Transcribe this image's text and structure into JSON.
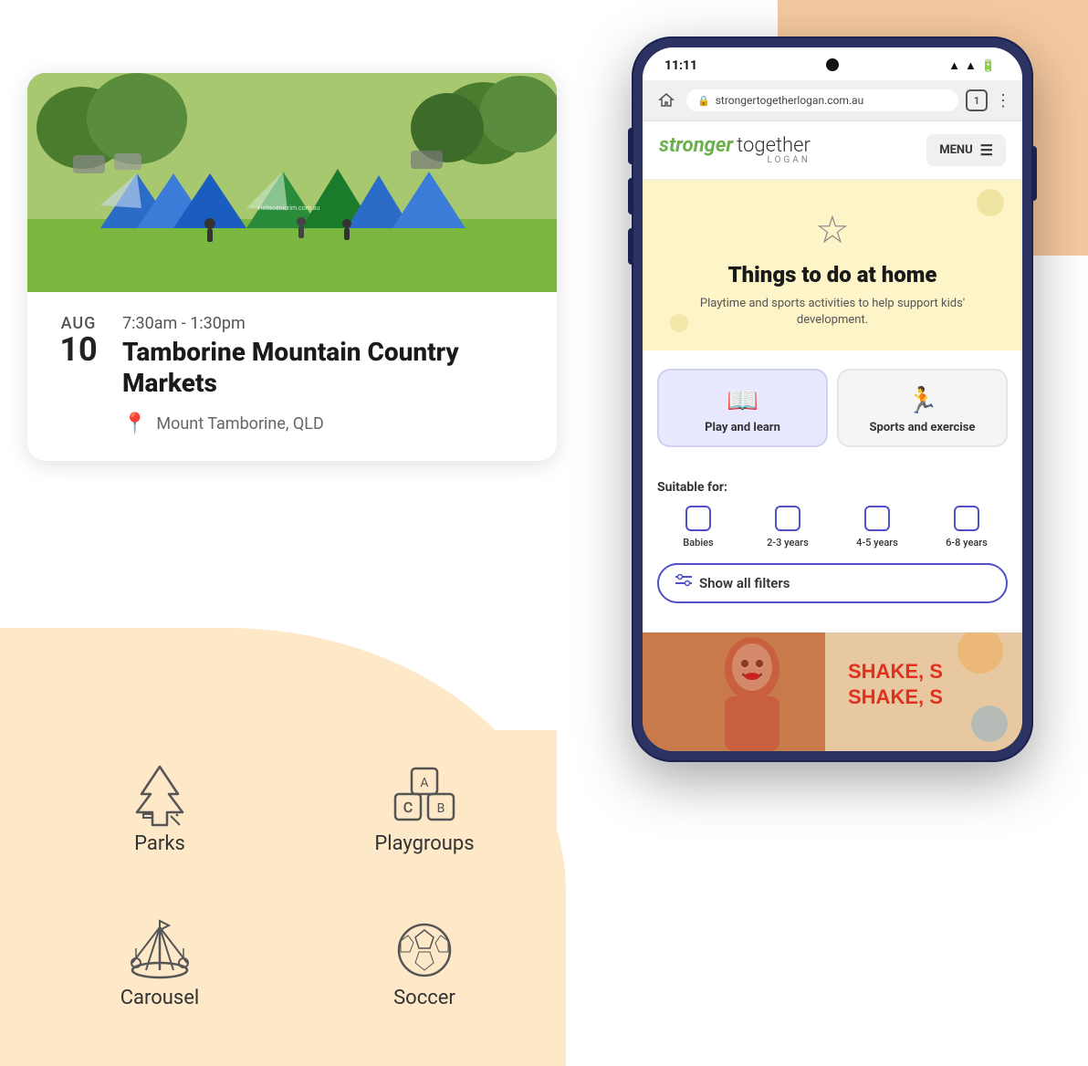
{
  "background": {
    "top_right_color": "#f5c9a0",
    "bottom_left_color": "#fde8c8"
  },
  "event_card": {
    "month": "AUG",
    "day": "10",
    "time": "7:30am - 1:30pm",
    "title": "Tamborine Mountain Country Markets",
    "location": "Mount Tamborine, QLD"
  },
  "categories": [
    {
      "id": "parks",
      "label": "Parks",
      "icon": "tree-icon"
    },
    {
      "id": "playgroups",
      "label": "Playgroups",
      "icon": "blocks-icon"
    },
    {
      "id": "carousel",
      "label": "Carousel",
      "icon": "carousel-icon"
    },
    {
      "id": "soccer",
      "label": "Soccer",
      "icon": "soccer-icon"
    }
  ],
  "phone": {
    "status_bar": {
      "time": "11:11",
      "battery_icon": "battery-icon",
      "signal_icon": "signal-icon",
      "wifi_icon": "wifi-icon"
    },
    "browser": {
      "url": "strongertogetherlogan.com.au",
      "tab_count": "1"
    },
    "site": {
      "logo_stronger": "stronger",
      "logo_together": "together",
      "logo_sub": "LOGAN",
      "menu_label": "MENU",
      "hero_title": "Things to do at home",
      "hero_subtitle": "Playtime and sports activities to help support kids' development.",
      "tabs": [
        {
          "id": "play-learn",
          "label": "Play and learn",
          "active": true,
          "icon": "book-icon"
        },
        {
          "id": "sports-exercise",
          "label": "Sports and exercise",
          "active": false,
          "icon": "sports-icon"
        }
      ],
      "suitable_for_label": "Suitable for:",
      "age_filters": [
        {
          "id": "babies",
          "label": "Babies"
        },
        {
          "id": "2-3-years",
          "label": "2-3 years"
        },
        {
          "id": "4-5-years",
          "label": "4-5 years"
        },
        {
          "id": "6-8-years",
          "label": "6-8 years"
        }
      ],
      "show_filters_label": "Show all filters",
      "video_text": "SHAKE, S\nSHAKE, S"
    }
  }
}
